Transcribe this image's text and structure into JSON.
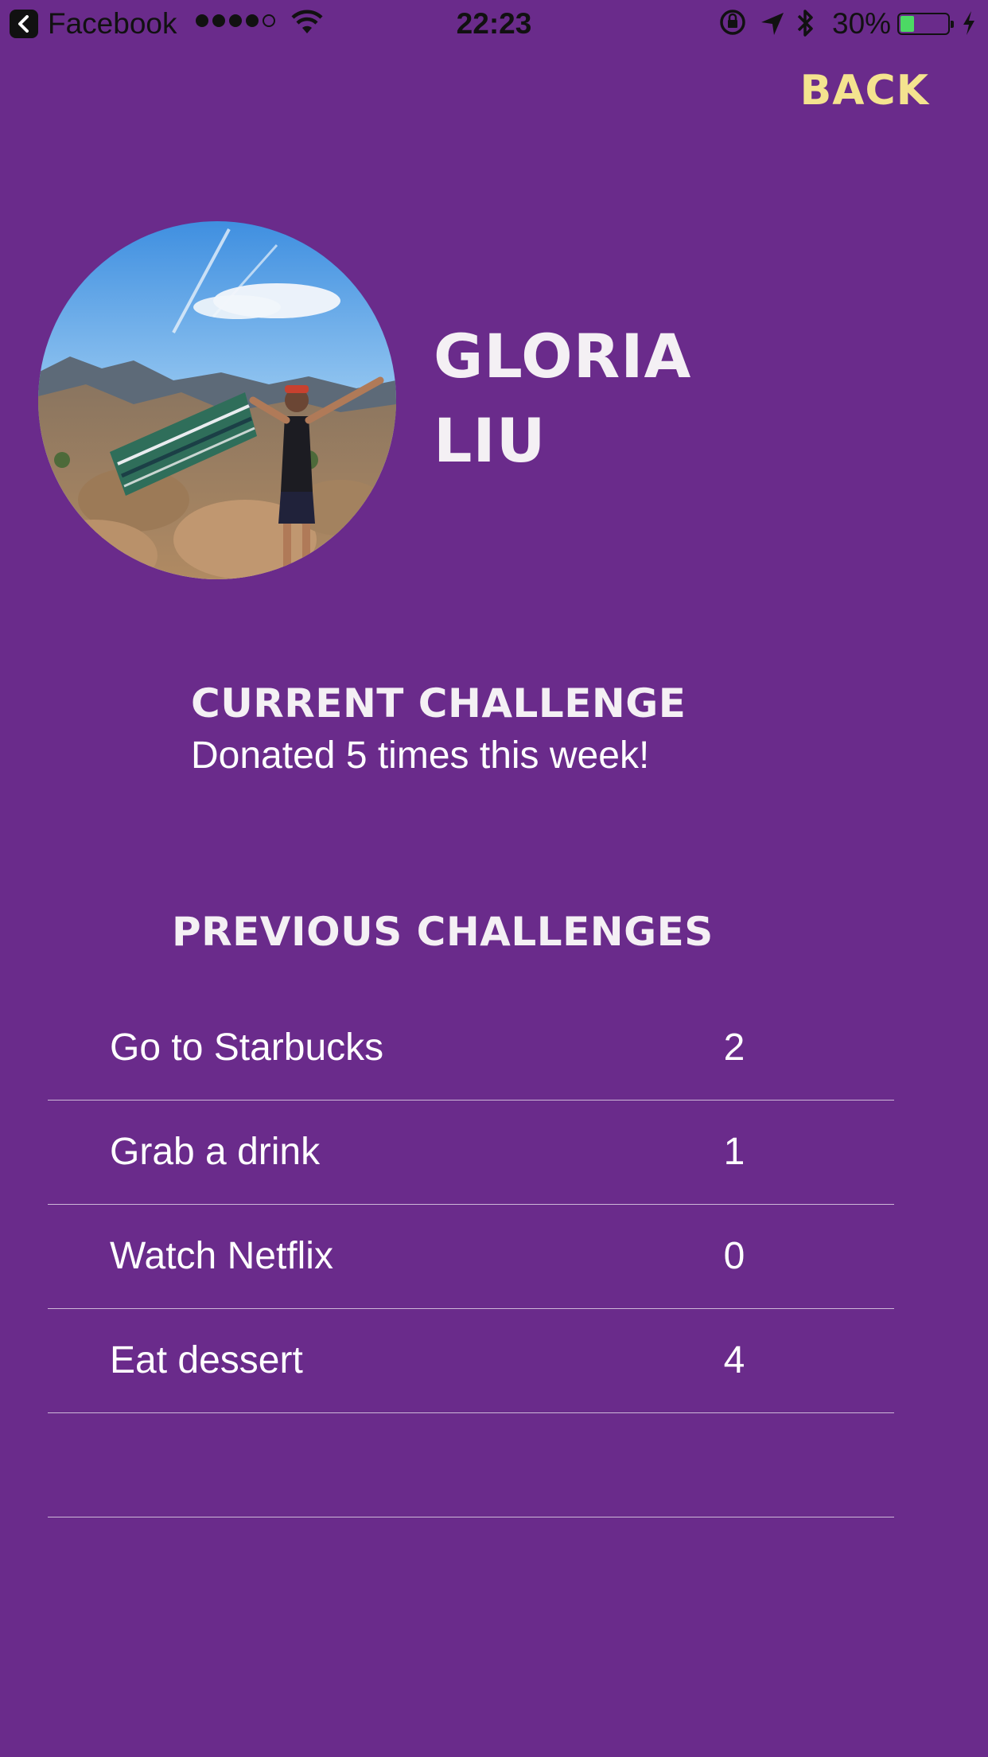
{
  "status_bar": {
    "app_name": "Facebook",
    "time": "22:23",
    "battery_percent": "30%",
    "battery_level": 0.3,
    "signal_bars_filled": 4,
    "signal_bars_total": 5
  },
  "nav": {
    "back_label": "BACK"
  },
  "profile": {
    "first_name": "GLORIA",
    "last_name": "LIU"
  },
  "current_challenge": {
    "title": "CURRENT CHALLENGE",
    "text": "Donated 5 times this week!"
  },
  "previous_challenges": {
    "title": "PREVIOUS CHALLENGES",
    "items": [
      {
        "name": "Go to Starbucks",
        "count": "2"
      },
      {
        "name": "Grab a drink",
        "count": "1"
      },
      {
        "name": "Watch Netflix",
        "count": "0"
      },
      {
        "name": "Eat dessert",
        "count": "4"
      },
      {
        "name": "",
        "count": ""
      }
    ]
  },
  "colors": {
    "background": "#6a2b8b",
    "accent": "#f4e38f",
    "text": "#ffffff",
    "divider": "#cdb8d8"
  }
}
